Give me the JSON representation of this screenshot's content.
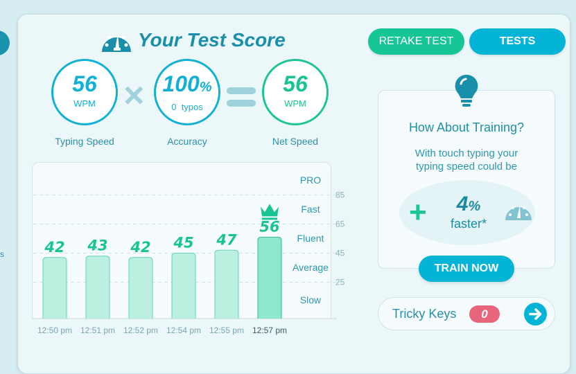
{
  "page": {
    "title": "Your Test Score",
    "side_fragment": "s"
  },
  "scores": {
    "typing_speed": {
      "value": "56",
      "unit": "WPM",
      "label": "Typing Speed"
    },
    "accuracy": {
      "value": "100",
      "suffix": "%",
      "sub": "0  typos",
      "label": "Accuracy"
    },
    "net_speed": {
      "value": "56",
      "unit": "WPM",
      "label": "Net Speed"
    }
  },
  "buttons": {
    "retake": "RETAKE TEST",
    "tests": "TESTS",
    "train": "TRAIN NOW"
  },
  "training": {
    "title": "How About Training?",
    "text_line1": "With touch typing your",
    "text_line2": "typing speed could be",
    "percent": "4",
    "percent_suffix": "%",
    "faster": "faster*"
  },
  "tricky_keys": {
    "label": "Tricky Keys",
    "count": "0"
  },
  "colors": {
    "accent_green": "#16c596",
    "accent_blue": "#04b4d6",
    "title_blue": "#1a8fa9",
    "badge_red": "#e8657c",
    "bar_fill": "#bbefe0"
  },
  "chart_data": {
    "type": "bar",
    "categories": [
      "12:50 pm",
      "12:51 pm",
      "12:52 pm",
      "12:54 pm",
      "12:55 pm",
      "12:57 pm"
    ],
    "values": [
      42,
      43,
      42,
      45,
      47,
      56
    ],
    "highlight_index": 5,
    "y_ticks": [
      25,
      45,
      65,
      85
    ],
    "ylim": [
      0,
      107
    ],
    "grid": true,
    "levels": [
      "PRO",
      "Fast",
      "Fluent",
      "Average",
      "Slow"
    ]
  }
}
